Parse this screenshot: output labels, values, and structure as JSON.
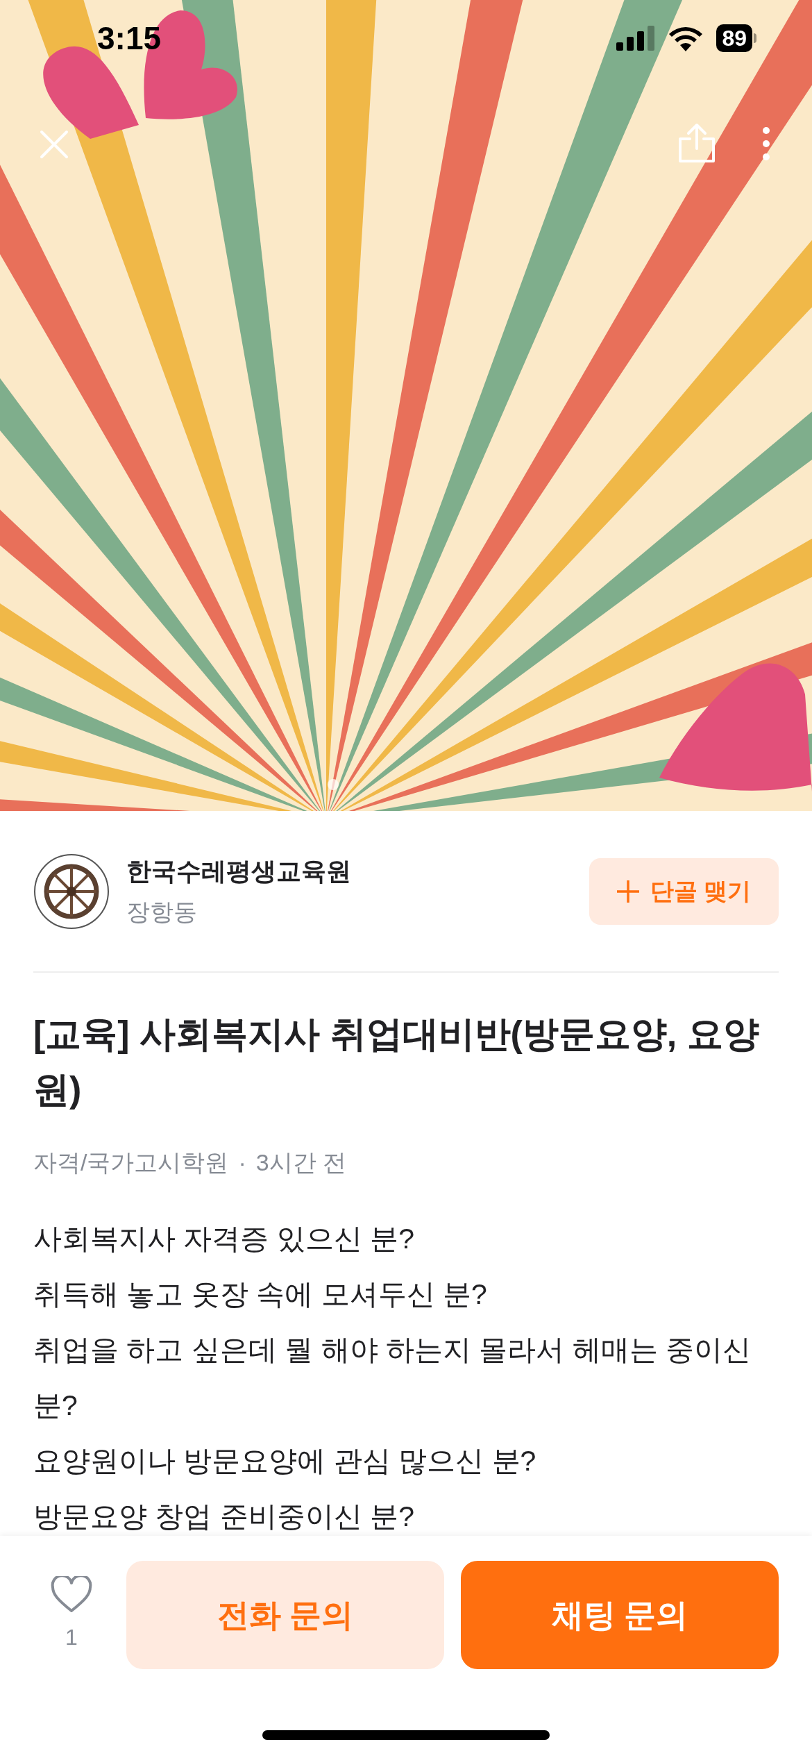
{
  "status_bar": {
    "time": "3:15",
    "battery": "89"
  },
  "post": {
    "author": {
      "name": "한국수레평생교육원",
      "location": "장항동"
    },
    "follow_button": "단골 맺기",
    "title": "[교육] 사회복지사 취업대비반(방문요양, 요양원)",
    "category": "자격/국가고시학원",
    "separator": "·",
    "time": "3시간 전",
    "body_lines": [
      "사회복지사 자격증 있으신 분?",
      "취득해 놓고 옷장 속에 모셔두신 분?",
      "취업을 하고 싶은데 뭘 해야 하는지 몰라서 헤매는 중이신 분?",
      "요양원이나 방문요양에 관심 많으신 분?",
      "방문요양 창업 준비중이신 분?"
    ]
  },
  "bottom_bar": {
    "like_count": "1",
    "liked": false,
    "call_button": "전화 문의",
    "chat_button": "채팅 문의"
  }
}
